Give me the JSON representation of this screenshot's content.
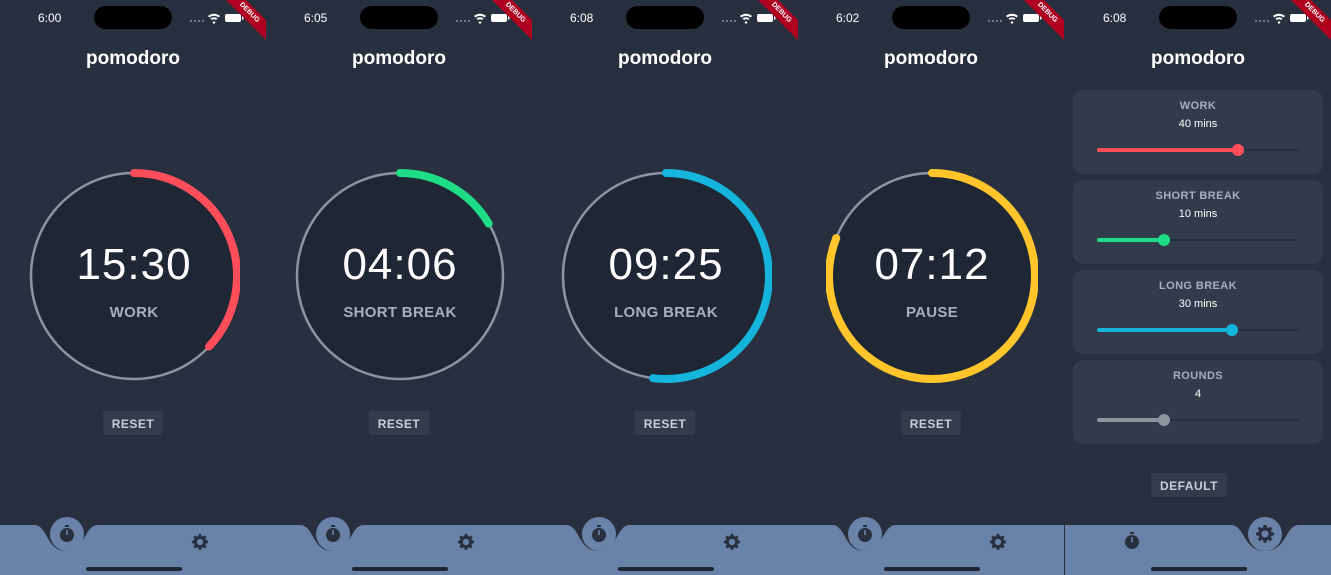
{
  "app_title": "pomodoro",
  "debug_label": "DEBUG",
  "colors": {
    "background": "#28303f",
    "navbar": "#6b82a8",
    "ring_track": "#8e959f",
    "work": "#ff4d5a",
    "short_break": "#1fdc86",
    "long_break": "#14b4dc",
    "pause": "#ffc52b",
    "rounds": "#8e959f"
  },
  "timers": [
    {
      "status_time": "6:00",
      "time": "15:30",
      "mode": "WORK",
      "color_key": "work",
      "arc_start": 0.0,
      "arc_end": 0.37,
      "reset_label": "RESET"
    },
    {
      "status_time": "6:05",
      "time": "04:06",
      "mode": "SHORT BREAK",
      "color_key": "short_break",
      "arc_start": 0.0,
      "arc_end": 0.165,
      "reset_label": "RESET"
    },
    {
      "status_time": "6:08",
      "time": "09:25",
      "mode": "LONG BREAK",
      "color_key": "long_break",
      "arc_start": 0.0,
      "arc_end": 0.52,
      "reset_label": "RESET"
    },
    {
      "status_time": "6:02",
      "time": "07:12",
      "mode": "PAUSE",
      "color_key": "pause",
      "arc_start": 0.0,
      "arc_end": 0.81,
      "reset_label": "RESET"
    }
  ],
  "settings": {
    "status_time": "6:08",
    "cards": [
      {
        "label": "WORK",
        "value": "40 mins",
        "fraction": 0.7,
        "color_key": "work"
      },
      {
        "label": "SHORT BREAK",
        "value": "10 mins",
        "fraction": 0.33,
        "color_key": "short_break"
      },
      {
        "label": "LONG BREAK",
        "value": "30 mins",
        "fraction": 0.67,
        "color_key": "long_break"
      },
      {
        "label": "ROUNDS",
        "value": "4",
        "fraction": 0.33,
        "color_key": "rounds"
      }
    ],
    "default_label": "DEFAULT"
  },
  "nav": {
    "timer_icon": "timer-icon",
    "settings_icon": "gear-icon"
  }
}
